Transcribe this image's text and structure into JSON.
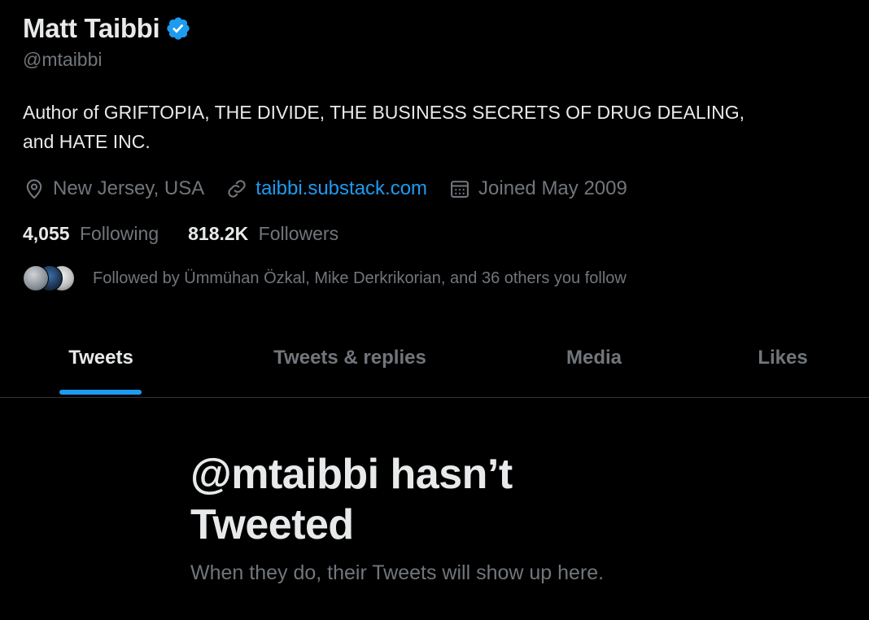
{
  "profile": {
    "display_name": "Matt Taibbi",
    "verified_icon": "verified-badge-icon",
    "handle": "@mtaibbi",
    "bio_line1": "Author of GRIFTOPIA, THE DIVIDE, THE BUSINESS SECRETS OF DRUG DEALING,",
    "bio_line2": "and HATE INC.",
    "location": "New Jersey, USA",
    "website": "taibbi.substack.com",
    "joined": "Joined May 2009"
  },
  "stats": {
    "following_count": "4,055",
    "following_label": "Following",
    "followers_count": "818.2K",
    "followers_label": "Followers"
  },
  "followed_by": {
    "text": "Followed by Ümmühan Özkal, Mike Derkrikorian, and 36 others you follow"
  },
  "tabs": [
    {
      "label": "Tweets",
      "active": true
    },
    {
      "label": "Tweets & replies",
      "active": false
    },
    {
      "label": "Media",
      "active": false
    },
    {
      "label": "Likes",
      "active": false
    }
  ],
  "empty_state": {
    "title": "@mtaibbi hasn’t Tweeted",
    "subtitle": "When they do, their Tweets will show up here."
  },
  "colors": {
    "background": "#000000",
    "text_primary": "#e7e9ea",
    "text_secondary": "#71767b",
    "accent": "#1d9bf0",
    "divider": "#2f3336"
  }
}
